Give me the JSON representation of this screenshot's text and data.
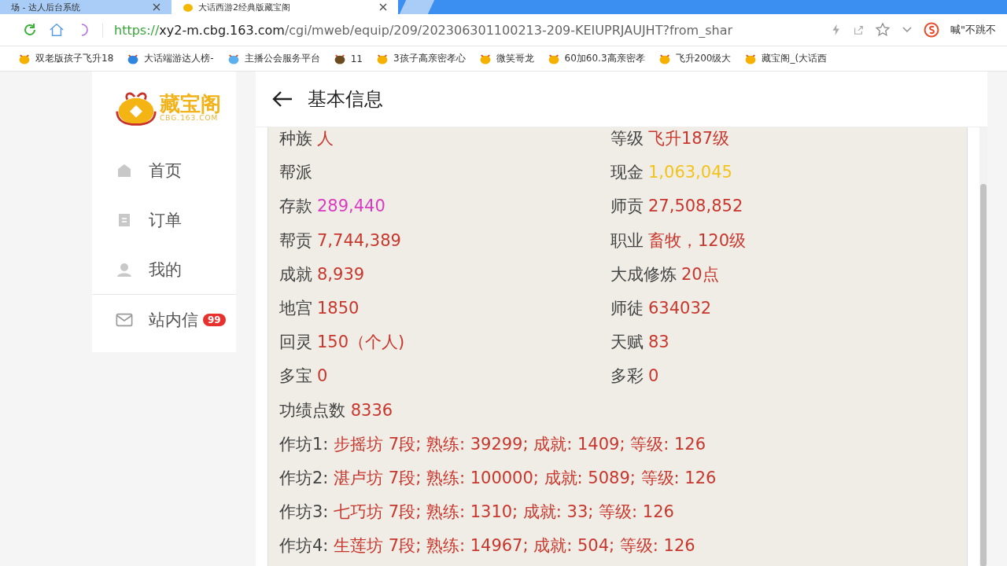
{
  "tabs": [
    {
      "title": "场 - 达人后台系统",
      "selected": false
    },
    {
      "title": "大话西游2经典版藏宝阁",
      "selected": true
    }
  ],
  "address_bar": {
    "url_scheme": "https://",
    "url_host": "xy2-m.cbg.163.com",
    "url_path": "/cgi/mweb/equip/209/202306301100213-209-KEIUPRJAUJHT?from_shar",
    "search_hint": "喊\"不跳不"
  },
  "bookmarks": [
    {
      "title": "双老版孩子飞升18"
    },
    {
      "title": "大话端游达人榜-"
    },
    {
      "title": "主播公会服务平台"
    },
    {
      "title": "11"
    },
    {
      "title": "3孩子高亲密孝心"
    },
    {
      "title": "微笑哥龙"
    },
    {
      "title": "60加60.3高亲密孝"
    },
    {
      "title": "飞升200级大"
    },
    {
      "title": "藏宝阁_(大话西"
    }
  ],
  "sidebar": {
    "logo": "藏宝阁",
    "logo_sub": "CBG.163.COM",
    "items": [
      {
        "label": "首页"
      },
      {
        "label": "订单"
      },
      {
        "label": "我的"
      },
      {
        "label": "站内信",
        "badge": "99"
      }
    ]
  },
  "header": {
    "title": "基本信息"
  },
  "fields": [
    {
      "label": "种族",
      "value": "人",
      "color": "#c8372d"
    },
    {
      "label": "等级",
      "value": "飞升187级",
      "color": "#c8372d"
    },
    {
      "label": "帮派"
    },
    {
      "label": "现金",
      "value": "1,063,045",
      "color": "#f2c31c"
    },
    {
      "label": "存款",
      "value": "289,440",
      "color": "#d83cc0"
    },
    {
      "label": "师贡",
      "value": "27,508,852",
      "color": "#c8372d"
    },
    {
      "label": "帮贡",
      "value": "7,744,389",
      "color": "#c8372d"
    },
    {
      "label": "职业",
      "value": "畜牧，120级",
      "color": "#c8372d"
    },
    {
      "label": "成就",
      "value": "8,939",
      "color": "#c8372d"
    },
    {
      "label": "大成修炼",
      "value": "20点",
      "color": "#c8372d"
    },
    {
      "label": "地宫",
      "value": "1850",
      "color": "#c8372d"
    },
    {
      "label": "师徒",
      "value": "634032",
      "color": "#c8372d"
    },
    {
      "label": "回灵",
      "value": "150（个人)",
      "color": "#c8372d"
    },
    {
      "label": "天赋",
      "value": "83",
      "color": "#c8372d"
    },
    {
      "label": "多宝",
      "value": "0",
      "color": "#c8372d"
    },
    {
      "label": "多彩",
      "value": "0",
      "color": "#c8372d"
    }
  ],
  "full_rows": [
    {
      "label": "功绩点数",
      "value": "8336"
    },
    {
      "label": "作坊1:",
      "value": "步摇坊 7段; 熟练: 39299; 成就: 1409; 等级: 126"
    },
    {
      "label": "作坊2:",
      "value": "湛卢坊 7段; 熟练: 100000; 成就: 5089; 等级: 126"
    },
    {
      "label": "作坊3:",
      "value": "七巧坊 7段; 熟练: 1310; 成就: 33; 等级: 126"
    },
    {
      "label": "作坊4:",
      "value": "生莲坊 7段; 熟练: 14967; 成就: 504; 等级: 126"
    }
  ]
}
